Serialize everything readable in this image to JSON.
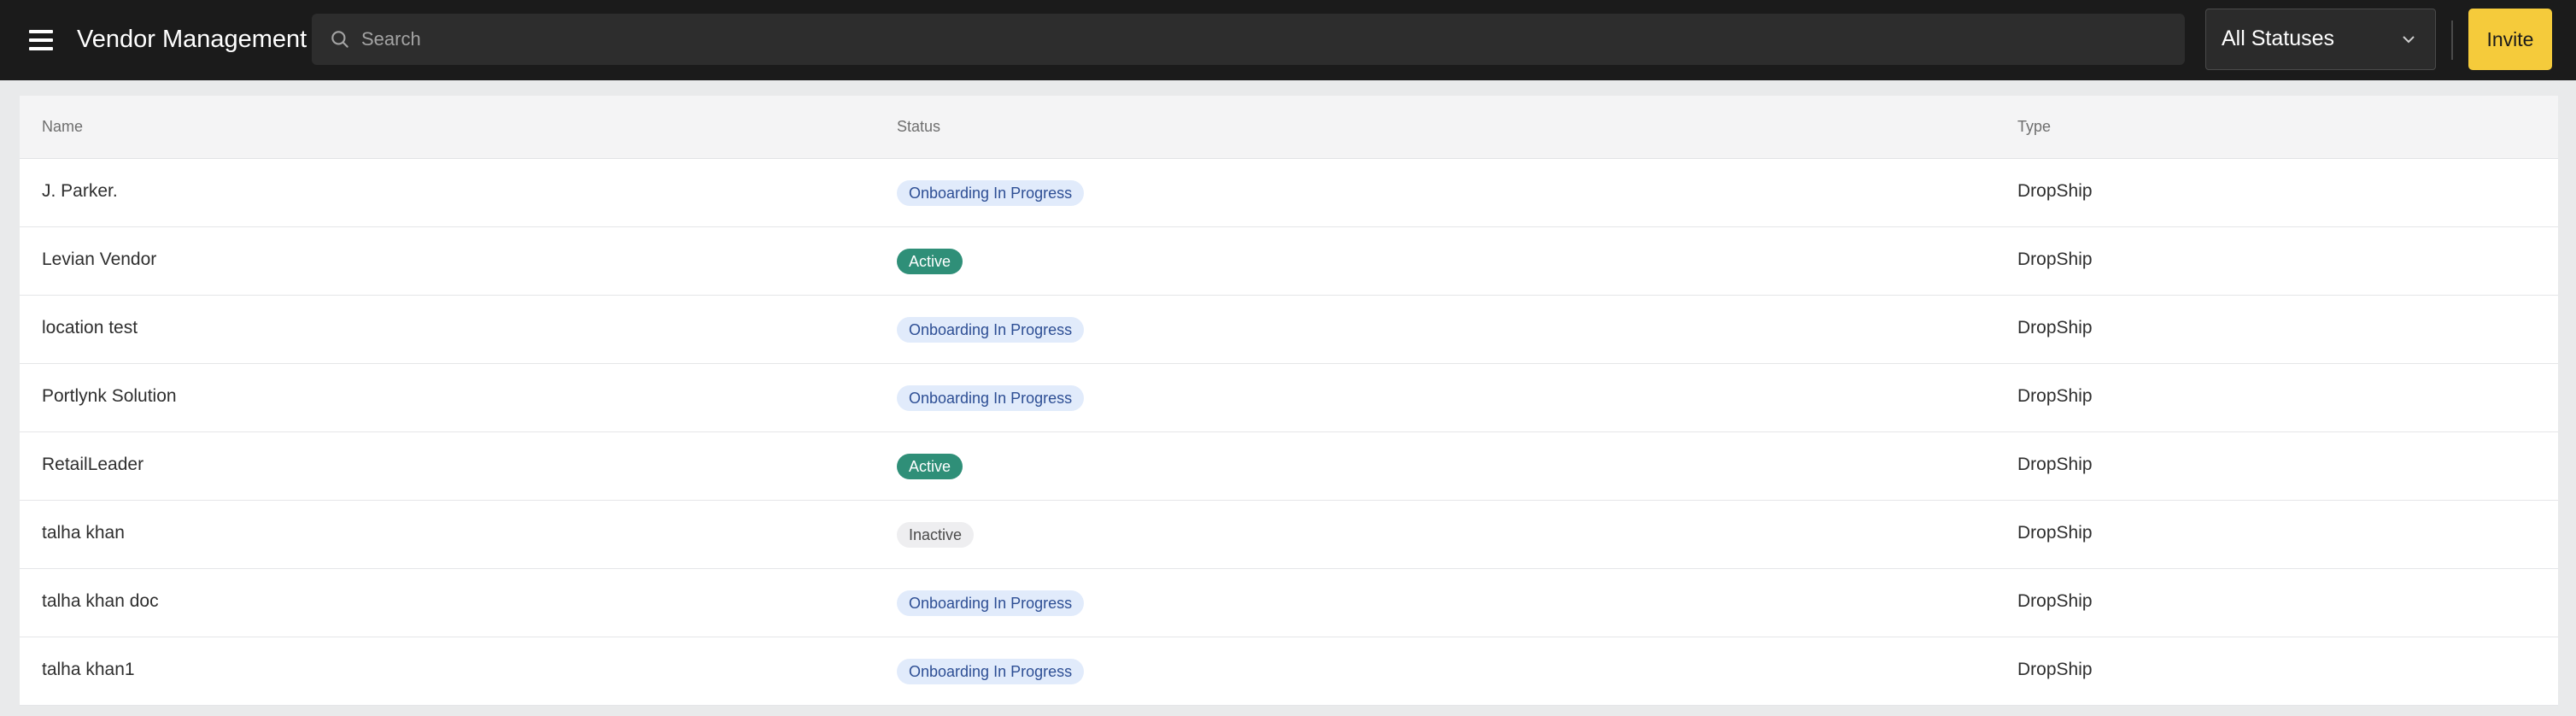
{
  "header": {
    "title": "Vendor Management",
    "search_placeholder": "Search",
    "search_value": "",
    "status_filter": "All Statuses",
    "invite_label": "Invite"
  },
  "table": {
    "columns": [
      "Name",
      "Status",
      "Type"
    ],
    "rows": [
      {
        "name": "J. Parker.",
        "status": "Onboarding In Progress",
        "status_kind": "onboarding",
        "type": "DropShip"
      },
      {
        "name": "Levian Vendor",
        "status": "Active",
        "status_kind": "active",
        "type": "DropShip"
      },
      {
        "name": "location test",
        "status": "Onboarding In Progress",
        "status_kind": "onboarding",
        "type": "DropShip"
      },
      {
        "name": "Portlynk Solution",
        "status": "Onboarding In Progress",
        "status_kind": "onboarding",
        "type": "DropShip"
      },
      {
        "name": "RetailLeader",
        "status": "Active",
        "status_kind": "active",
        "type": "DropShip"
      },
      {
        "name": "talha khan",
        "status": "Inactive",
        "status_kind": "inactive",
        "type": "DropShip"
      },
      {
        "name": "talha khan doc",
        "status": "Onboarding In Progress",
        "status_kind": "onboarding",
        "type": "DropShip"
      },
      {
        "name": "talha khan1",
        "status": "Onboarding In Progress",
        "status_kind": "onboarding",
        "type": "DropShip"
      }
    ]
  },
  "colors": {
    "topbar": "#1b1b1b",
    "accent": "#f5cb3b",
    "active_badge": "#2f8f78",
    "onboarding_badge": "#e1ebfb",
    "inactive_badge": "#eeeef0"
  },
  "icons": {
    "menu": "hamburger-menu-icon",
    "search": "search-icon",
    "dropdown": "chevron-down-icon"
  }
}
